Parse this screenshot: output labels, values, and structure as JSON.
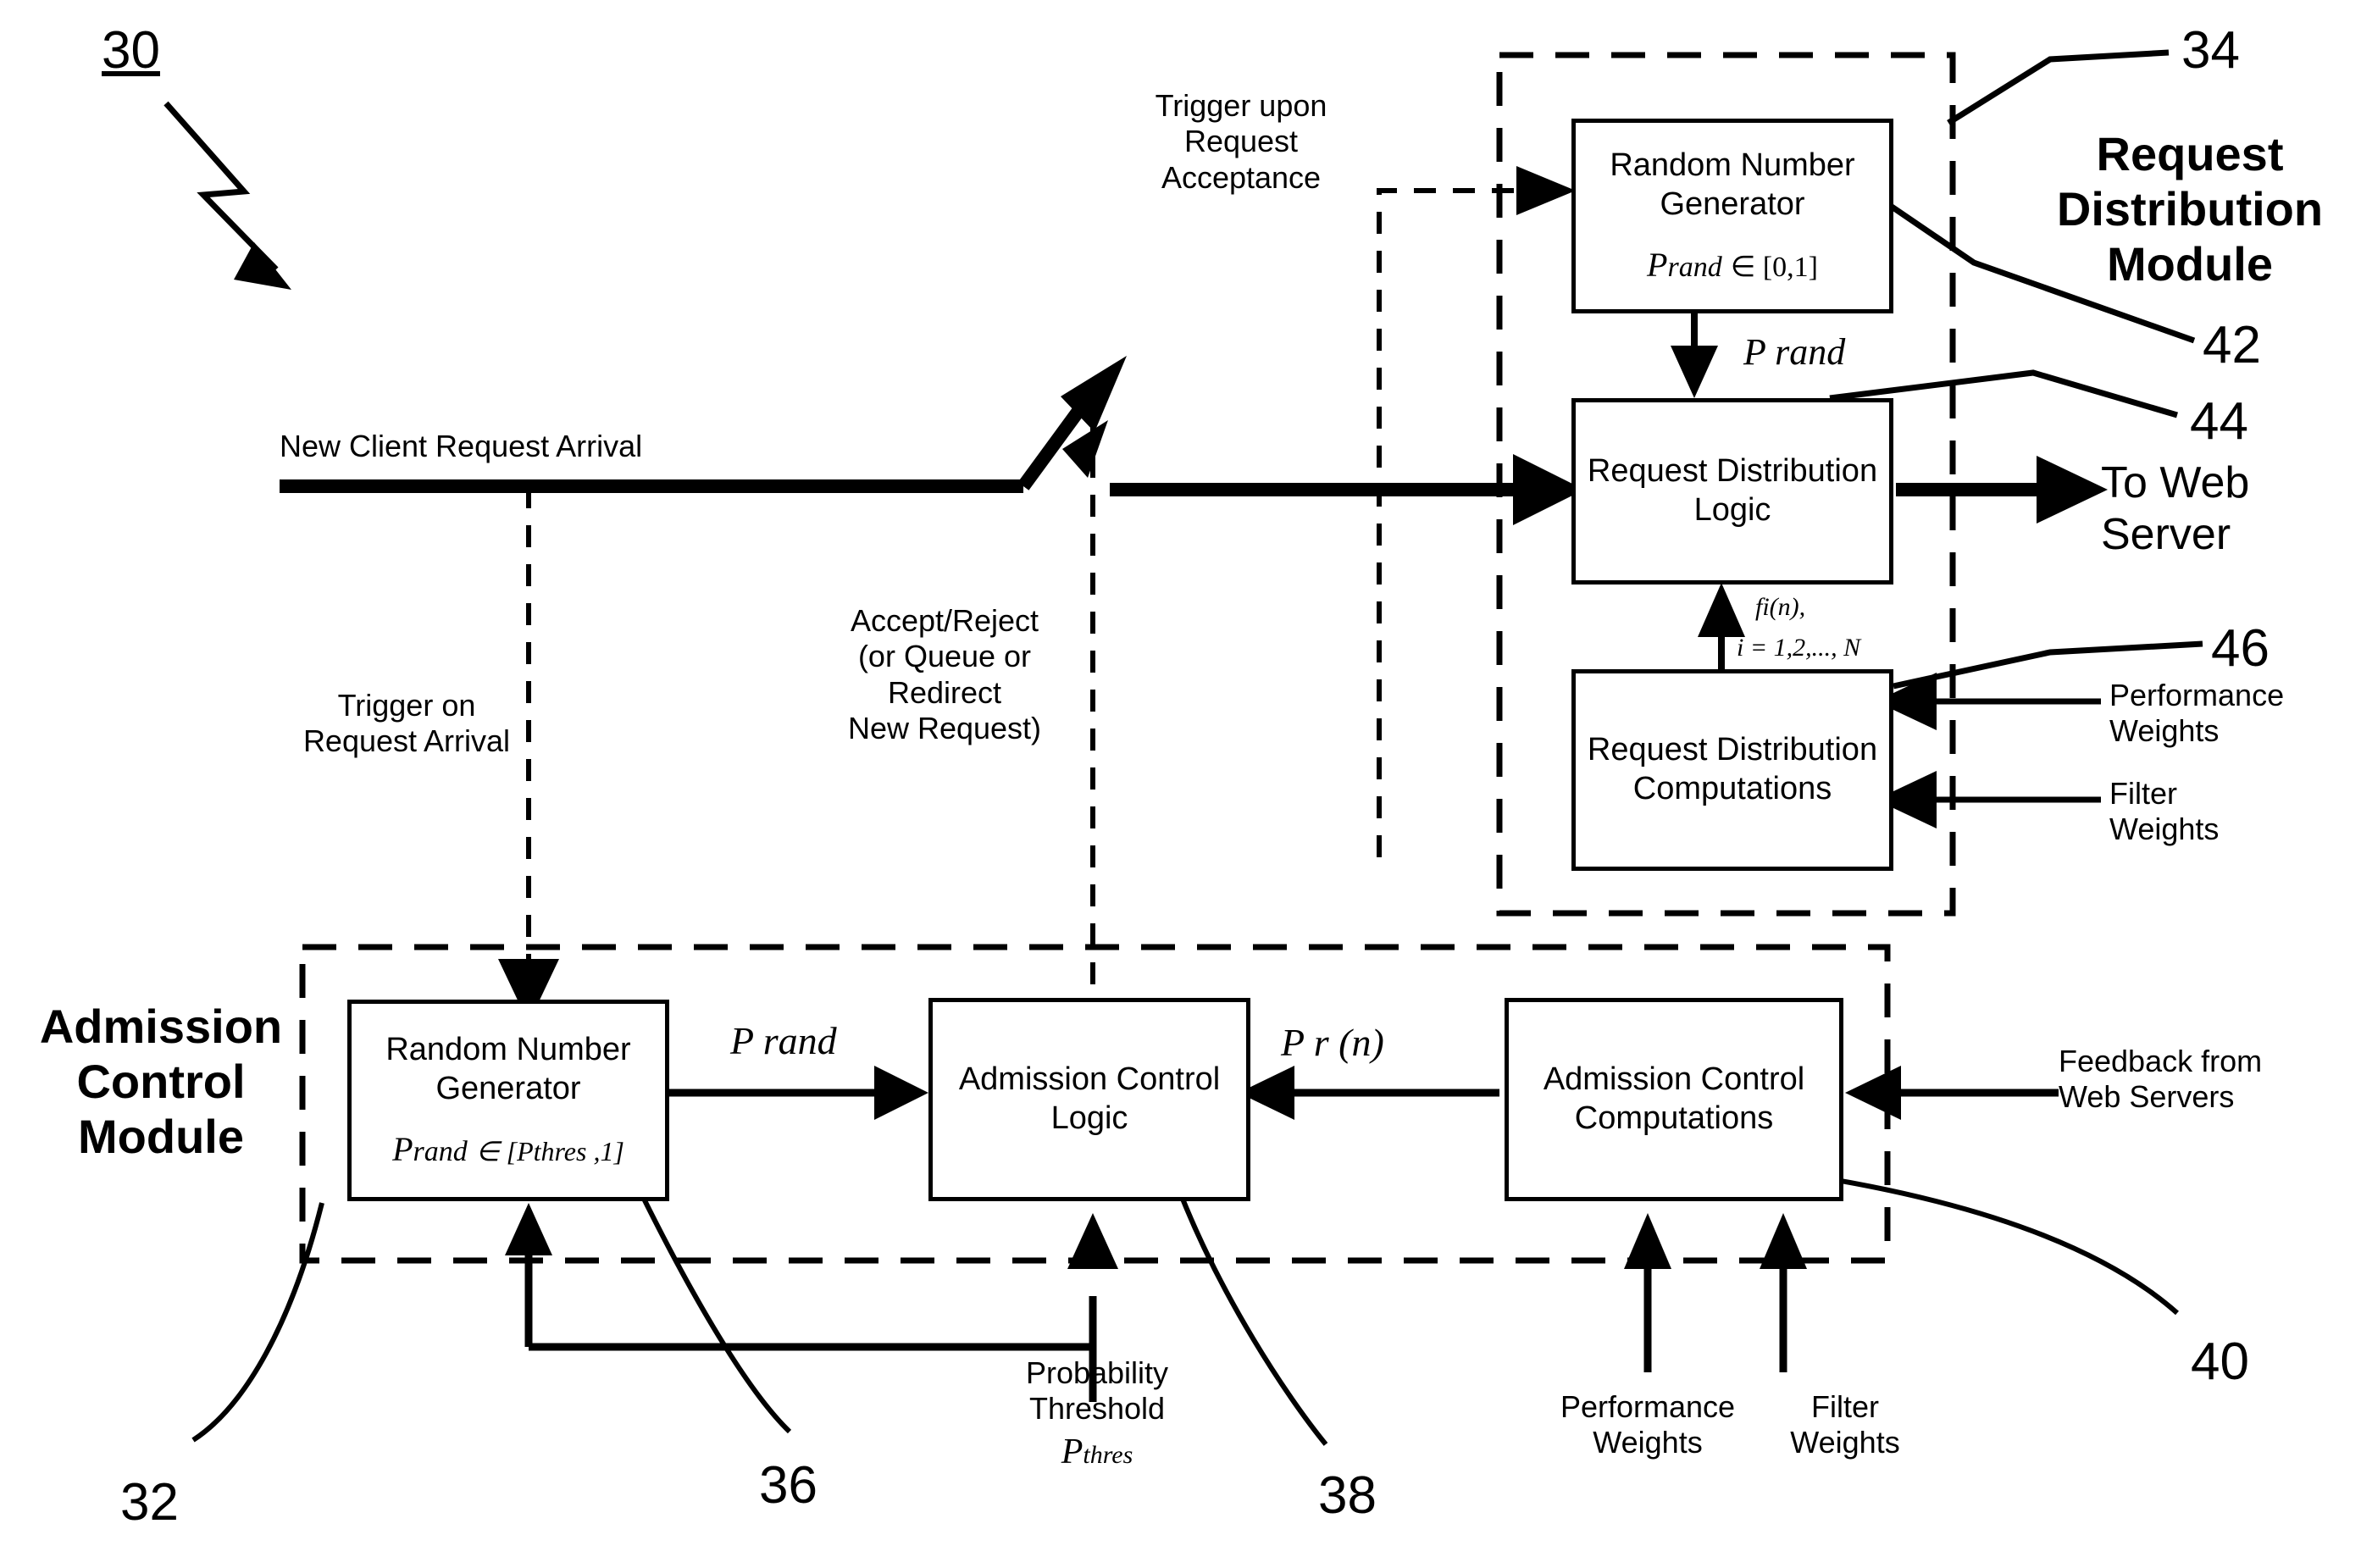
{
  "figure": {
    "ref_main": "30",
    "refs": {
      "admission_module": "32",
      "request_distribution_module": "34",
      "rng_ac": "36",
      "ac_logic": "38",
      "ac_computations": "40",
      "rng_rd": "42",
      "rd_logic": "44",
      "rd_computations": "46"
    }
  },
  "request_distribution_module": {
    "title": "Request\nDistribution\nModule",
    "rng": {
      "title": "Random Number\nGenerator",
      "formula_p": "P",
      "formula_sub": "rand",
      "formula_rest": "∈ [0,1]"
    },
    "logic": {
      "title": "Request\nDistribution Logic"
    },
    "computations": {
      "title": "Request\nDistribution\nComputations"
    },
    "prand_edge_label": "P rand",
    "fi_label_line1": "fi(n),",
    "fi_label_line2": "i = 1,2,..., N",
    "performance_weights": "Performance\nWeights",
    "filter_weights": "Filter\nWeights",
    "to_web_server": "To Web\nServer"
  },
  "admission_control_module": {
    "title": "Admission\nControl\nModule",
    "rng": {
      "title": "Random Number\nGenerator",
      "formula_p": "P",
      "formula_sub": "rand",
      "formula_rest": "∈ [Pthres ,1]"
    },
    "logic": {
      "title": "Admission\nControl\nLogic"
    },
    "computations": {
      "title": "Admission Control\nComputations"
    },
    "prand_edge_label": "P rand",
    "pr_edge_label": "P  r   (n)",
    "feedback_label": "Feedback from\nWeb Servers",
    "probability_threshold": "Probability\nThreshold",
    "probability_threshold_symbol": "P",
    "probability_threshold_sub": "thres",
    "performance_weights": "Performance\nWeights",
    "filter_weights": "Filter\nWeights"
  },
  "flow_labels": {
    "new_client_request_arrival": "New Client Request Arrival",
    "trigger_on_request_arrival": "Trigger on\nRequest Arrival",
    "accept_reject": "Accept/Reject\n(or Queue or\nRedirect\nNew Request)",
    "trigger_upon_request_acceptance": "Trigger upon\nRequest\nAcceptance"
  },
  "colors": {
    "ink": "#000000",
    "paper": "#ffffff"
  }
}
